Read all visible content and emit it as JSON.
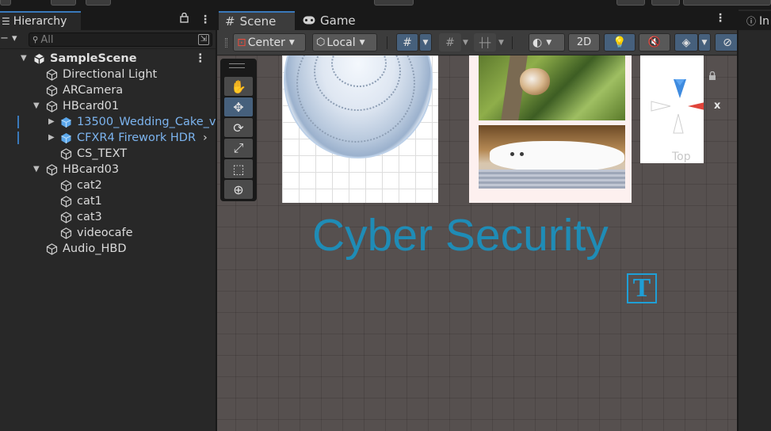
{
  "hierarchy": {
    "tab_label": "Hierarchy",
    "search_placeholder": "All",
    "scene_name": "SampleScene",
    "items": [
      {
        "label": "Directional Light"
      },
      {
        "label": "ARCamera"
      },
      {
        "label": "HBcard01"
      },
      {
        "label": "13500_Wedding_Cake_v"
      },
      {
        "label": "CFXR4 Firework HDR"
      },
      {
        "label": "CS_TEXT"
      },
      {
        "label": "HBcard03"
      },
      {
        "label": "cat2"
      },
      {
        "label": "cat1"
      },
      {
        "label": "cat3"
      },
      {
        "label": "videocafe"
      },
      {
        "label": "Audio_HBD"
      }
    ]
  },
  "scene": {
    "tabs": [
      {
        "label": "Scene"
      },
      {
        "label": "Game"
      }
    ],
    "toolbar": {
      "pivot_label": "Center",
      "space_label": "Local",
      "mode_2d_label": "2D"
    },
    "gizmo": {
      "axis_label": "x",
      "view_label": "Top"
    },
    "text_object": "Cyber Security",
    "text_icon_glyph": "T"
  },
  "inspector": {
    "tab_label": "In"
  },
  "colors": {
    "accent": "#3a79bb",
    "prefab_text": "#7cb4ef",
    "scene_text": "#1f8cb6"
  }
}
